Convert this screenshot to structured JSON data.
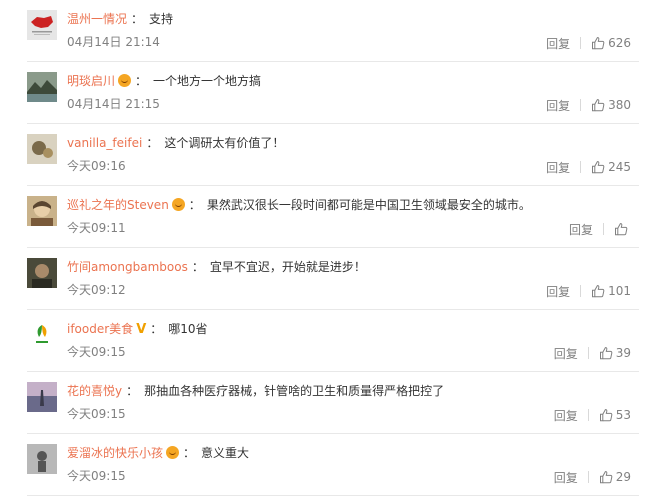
{
  "comments": [
    {
      "username": "温州一情况",
      "badge": "",
      "text": "支持",
      "time": "04月14日 21:14",
      "reply_label": "回复",
      "likes": "626",
      "avatar": "red-map-avatar",
      "avatar_colors": [
        "#e6e6e6",
        "#cc2222"
      ]
    },
    {
      "username": "明琰启川",
      "badge": "emoji",
      "text": "一个地方一个地方搞",
      "time": "04月14日 21:15",
      "reply_label": "回复",
      "likes": "380",
      "avatar": "landscape-avatar",
      "avatar_colors": [
        "#8a9a8a",
        "#3d4a3a"
      ]
    },
    {
      "username": "vanilla_feifei",
      "badge": "",
      "text": "这个调研太有价值了！",
      "time": "今天09:16",
      "reply_label": "回复",
      "likes": "245",
      "avatar": "flower-avatar",
      "avatar_colors": [
        "#d9d2c0",
        "#7a6a4a"
      ]
    },
    {
      "username": "巡礼之年的Steven",
      "badge": "emoji",
      "text": "果然武汉很长一段时间都可能是中国卫生领域最安全的城市。",
      "time": "今天09:11",
      "reply_label": "回复",
      "likes": "",
      "avatar": "anime-avatar",
      "avatar_colors": [
        "#c9b28a",
        "#5a4630"
      ]
    },
    {
      "username": "竹间amongbamboos",
      "badge": "",
      "text": "宜早不宜迟，开始就是进步！",
      "time": "今天09:12",
      "reply_label": "回复",
      "likes": "101",
      "avatar": "portrait-avatar",
      "avatar_colors": [
        "#4a4a3a",
        "#a88a6a"
      ]
    },
    {
      "username": "ifooder美食",
      "badge": "v",
      "text": "哪10省",
      "time": "今天09:15",
      "reply_label": "回复",
      "likes": "39",
      "avatar": "ifooder-logo-avatar",
      "avatar_colors": [
        "#ffffff",
        "#2f9a2f"
      ]
    },
    {
      "username": "花的喜悦y",
      "badge": "",
      "text": "那抽血各种医疗器械，针管啥的卫生和质量得严格把控了",
      "time": "今天09:15",
      "reply_label": "回复",
      "likes": "53",
      "avatar": "sky-avatar",
      "avatar_colors": [
        "#6a6a8a",
        "#c4b0c8"
      ]
    },
    {
      "username": "爱溜冰的快乐小孩",
      "badge": "emoji",
      "text": "意义重大",
      "time": "今天09:15",
      "reply_label": "回复",
      "likes": "29",
      "avatar": "figure-avatar",
      "avatar_colors": [
        "#b8b8b8",
        "#555555"
      ]
    }
  ],
  "separator": "："
}
